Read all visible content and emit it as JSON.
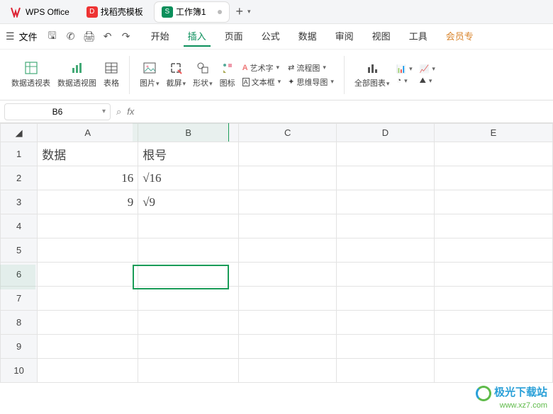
{
  "titlebar": {
    "app_name": "WPS Office",
    "tab_template": "找稻壳模板",
    "tab_workbook": "工作簿1"
  },
  "menubar": {
    "file": "文件",
    "tabs": {
      "start": "开始",
      "insert": "插入",
      "page": "页面",
      "formula": "公式",
      "data": "数据",
      "review": "审阅",
      "view": "视图",
      "tool": "工具",
      "member": "会员专"
    }
  },
  "ribbon": {
    "pivotTable": "数据透视表",
    "pivotChart": "数据透视图",
    "table": "表格",
    "picture": "图片",
    "screenshot": "截屏",
    "shape": "形状",
    "icon": "图标",
    "wordart": "艺术字",
    "textbox": "文本框",
    "flowchart": "流程图",
    "mindmap": "思维导图",
    "allCharts": "全部图表"
  },
  "namebox": {
    "value": "B6"
  },
  "formula": {
    "fx": "fx"
  },
  "grid": {
    "cols": [
      "A",
      "B",
      "C",
      "D",
      "E"
    ],
    "rows": [
      "1",
      "2",
      "3",
      "4",
      "5",
      "6",
      "7",
      "8",
      "9",
      "10"
    ],
    "cells": {
      "A1": "数据",
      "B1": "根号",
      "A2": "16",
      "B2": "√16",
      "A3": "9",
      "B3": "√9"
    }
  },
  "watermark": {
    "title": "极光下载站",
    "url": "www.xz7.com"
  }
}
